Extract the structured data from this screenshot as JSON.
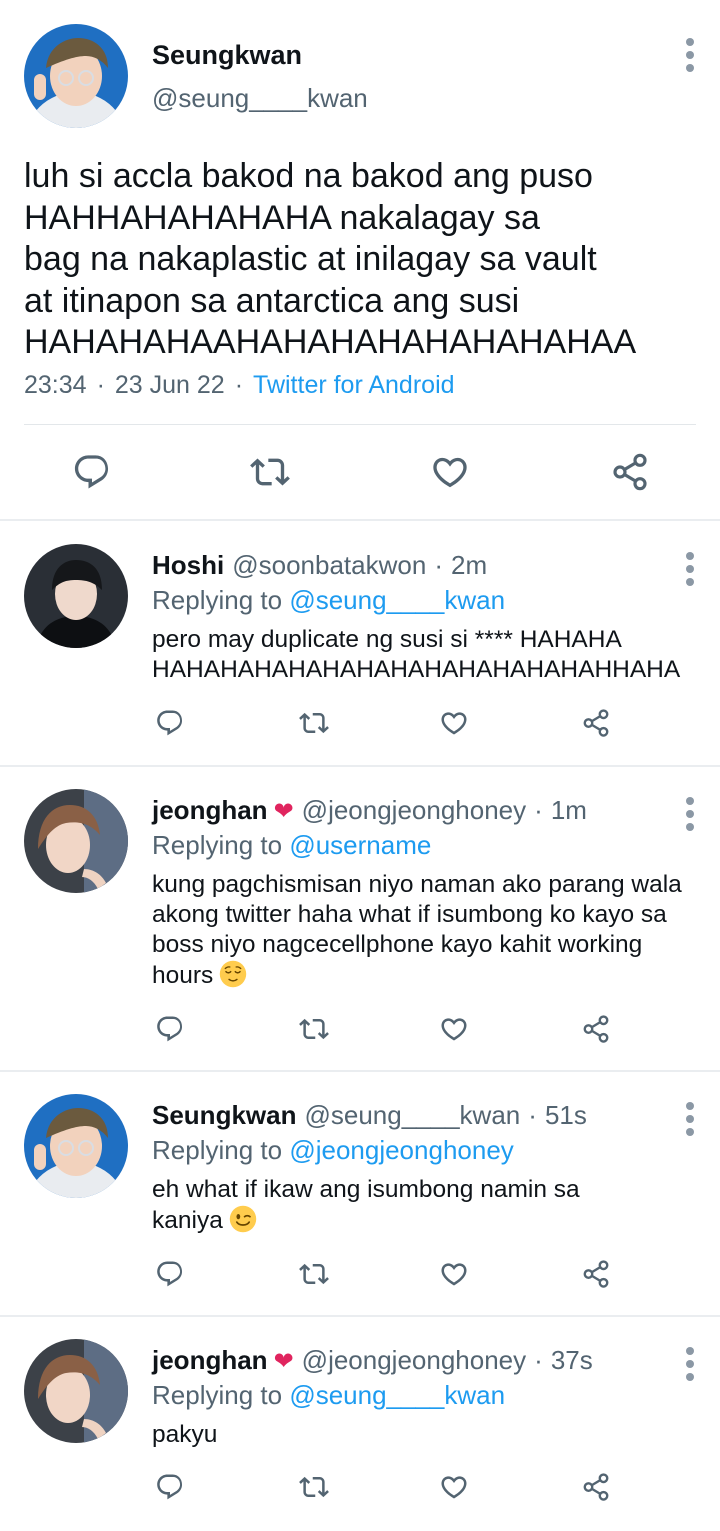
{
  "main_tweet": {
    "author_name": "Seungkwan",
    "author_handle": "@seung____kwan",
    "text": "luh si accla bakod na bakod ang puso\nHAHHAHAHAHAHA nakalagay sa\nbag na nakaplastic at inilagay sa vault\nat itinapon sa antarctica ang susi\nHAHAHAHAAHAHAHAHAHAHAHAHAA",
    "time": "23:34",
    "date": "23 Jun 22",
    "source": "Twitter for Android",
    "separator": "·"
  },
  "icons": {
    "reply": "reply-icon",
    "retweet": "retweet-icon",
    "like": "like-icon",
    "share": "share-icon",
    "more": "more-options-icon",
    "heart_emoji": "red-heart-emoji",
    "relieved_emoji": "relieved-face-emoji",
    "wink_emoji": "winking-face-emoji"
  },
  "colors": {
    "link": "#1d9bf0",
    "secondary_text": "#536471",
    "primary_text": "#0f1419",
    "icon": "#536471",
    "heart": "#e0245e"
  },
  "reply_prefix": "Replying to",
  "heart_glyph": "❤",
  "replies": [
    {
      "name": "Hoshi",
      "handle": "@soonbatakwon",
      "time": "2m",
      "replying_to": "@seung____kwan",
      "text": "pero may duplicate ng susi si **** HAHAHA HAHAHAHAHAHAHAHAHAHAHAHAHAHHAHA"
    },
    {
      "name": "jeonghan",
      "handle": "@jeongjeonghoney",
      "time": "1m",
      "replying_to": "@username",
      "text": "kung pagchismisan niyo naman ako parang wala akong twitter haha what if isumbong ko kayo sa boss niyo nagcecellphone kayo kahit working hours"
    },
    {
      "name": "Seungkwan",
      "handle": "@seung____kwan",
      "time": "51s",
      "replying_to": "@jeongjeonghoney",
      "text": "eh what if ikaw ang isumbong namin sa kaniya"
    },
    {
      "name": "jeonghan",
      "handle": "@jeongjeonghoney",
      "time": "37s",
      "replying_to": "@seung____kwan",
      "text": "pakyu"
    }
  ]
}
